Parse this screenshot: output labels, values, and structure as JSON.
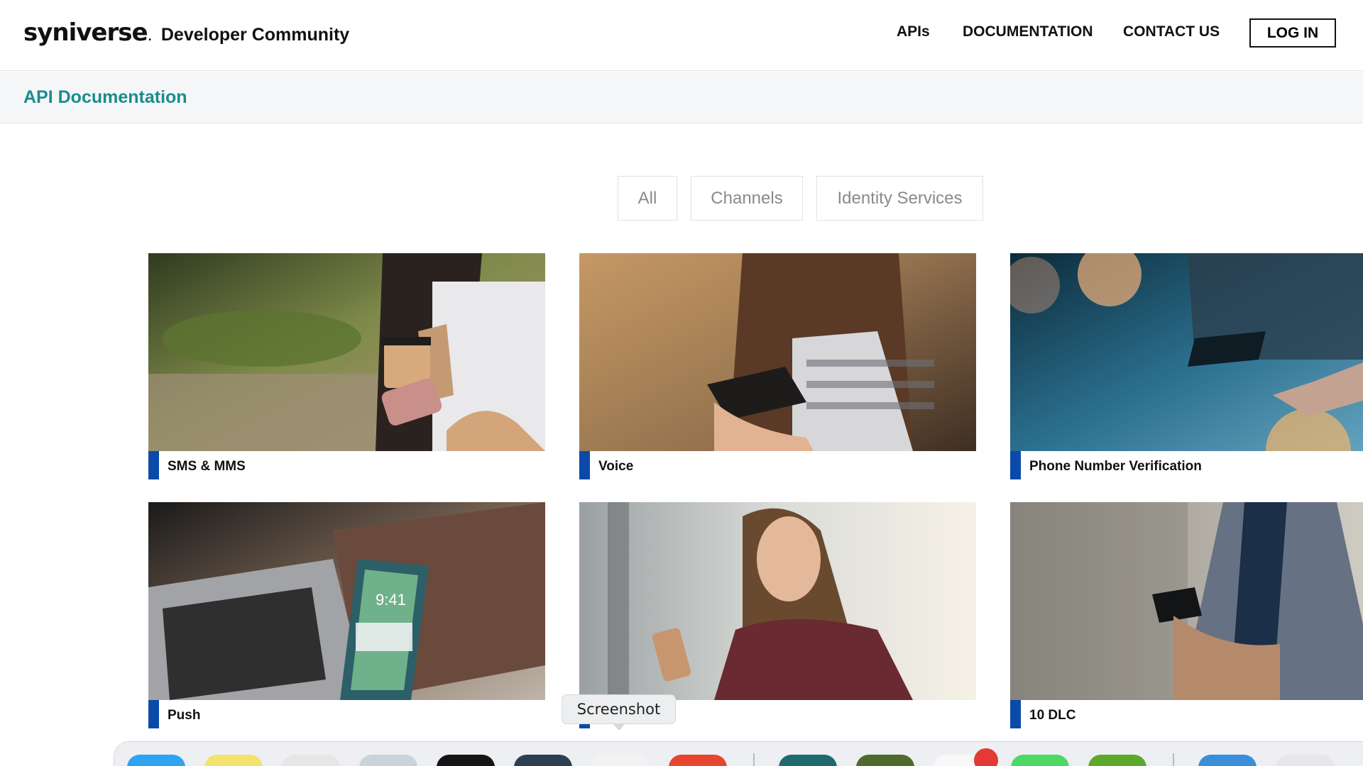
{
  "header": {
    "logo": "syniverse",
    "logo_dot": ".",
    "product": "Developer Community",
    "nav": [
      "APIs",
      "DOCUMENTATION",
      "CONTACT US"
    ],
    "login": "LOG IN"
  },
  "subheader": {
    "title": "API Documentation"
  },
  "filters": [
    "All",
    "Channels",
    "Identity Services"
  ],
  "cards": [
    {
      "label": "SMS & MMS"
    },
    {
      "label": "Voice"
    },
    {
      "label": "Phone Number Verification"
    },
    {
      "label": "Push"
    },
    {
      "label": ""
    },
    {
      "label": "10 DLC"
    }
  ],
  "tooltip": "Screenshot",
  "colors": {
    "accent": "#1a8c8f",
    "card_bar": "#0b4aa8",
    "subbar_bg": "#f5f6f7"
  },
  "dock": {
    "icons": [
      "finder-icon",
      "notes-icon",
      "mail-icon",
      "safari-icon",
      "terminal-icon",
      "app-icon",
      "photos-icon",
      "chrome-icon",
      "network-icon",
      "app2-icon",
      "calendar-icon",
      "messages-icon",
      "tool-icon",
      "files-icon",
      "trash-icon"
    ]
  }
}
